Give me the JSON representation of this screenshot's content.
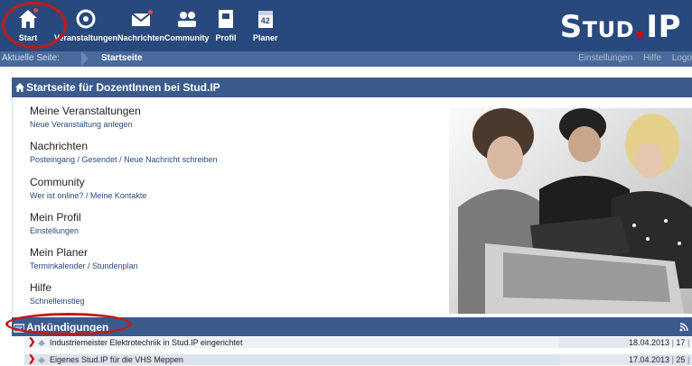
{
  "nav": {
    "items": [
      {
        "label": "Start",
        "icon": "home-icon"
      },
      {
        "label": "Veranstaltungen",
        "icon": "seminar-icon"
      },
      {
        "label": "Nachrichten",
        "icon": "mail-icon"
      },
      {
        "label": "Community",
        "icon": "community-icon"
      },
      {
        "label": "Profil",
        "icon": "profile-icon"
      },
      {
        "label": "Planer",
        "icon": "calendar-icon"
      }
    ],
    "calendar_day": "42",
    "logo_main": "Stud",
    "logo_dot": ".",
    "logo_end": "IP"
  },
  "breadcrumb": {
    "label": "Aktuelle Seite:",
    "current": "Startseite",
    "links": [
      "Einstellungen",
      "Hilfe",
      "Logo"
    ]
  },
  "panel": {
    "title": "Startseite für DozentInnen bei Stud.IP",
    "entries": [
      {
        "title": "Meine Veranstaltungen",
        "sub": "Neue Veranstaltung anlegen"
      },
      {
        "title": "Nachrichten",
        "sub": "Posteingang / Gesendet / Neue Nachricht schreiben"
      },
      {
        "title": "Community",
        "sub": "Wer ist online? / Meine Kontakte"
      },
      {
        "title": "Mein Profil",
        "sub": "Einstellungen"
      },
      {
        "title": "Mein Planer",
        "sub": "Terminkalender / Stundenplan"
      },
      {
        "title": "Hilfe",
        "sub": "Schnelleinstieg"
      }
    ]
  },
  "announcements": {
    "title": "Ankündigungen",
    "rows": [
      {
        "title": "Industriemeister Elektrotechnik in Stud.IP eingerichtet",
        "date": "18.04.2013",
        "views": "17",
        "extra": ""
      },
      {
        "title": "Eigenes Stud.IP für die VHS Meppen",
        "date": "17.04.2013",
        "views": "25",
        "extra": ""
      }
    ]
  },
  "colors": {
    "nav_bg": "#28497c",
    "crumb_bg": "#4a6a9c",
    "panel_head": "#3b5b8c",
    "highlight": "#c11a1a",
    "badge": "#e7484d"
  }
}
